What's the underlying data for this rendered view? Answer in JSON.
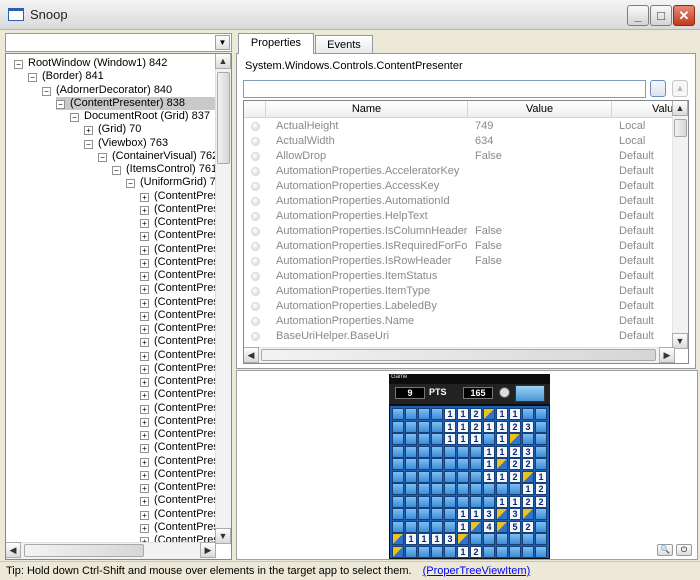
{
  "window": {
    "title": "Snoop",
    "min_symbol": "_",
    "max_symbol": "□",
    "close_symbol": "✕",
    "icon": "window-icon"
  },
  "tree": {
    "items": [
      {
        "label": "RootWindow (Window1) 842",
        "level": 0,
        "expander": "⊟"
      },
      {
        "label": "(Border) 841",
        "level": 1,
        "expander": "⊟"
      },
      {
        "label": "(AdornerDecorator) 840",
        "level": 2,
        "expander": "⊟"
      },
      {
        "label": "(ContentPresenter) 838",
        "level": 3,
        "expander": "⊟",
        "selected": true
      },
      {
        "label": "DocumentRoot (Grid) 837",
        "level": 4,
        "expander": "⊟"
      },
      {
        "label": "(Grid) 70",
        "level": 5,
        "expander": "⊞"
      },
      {
        "label": "(Viewbox) 763",
        "level": 5,
        "expander": "⊟"
      },
      {
        "label": "(ContainerVisual) 762",
        "level": 6,
        "expander": "⊟"
      },
      {
        "label": "(ItemsControl) 761",
        "level": 7,
        "expander": "⊟"
      },
      {
        "label": "(UniformGrid) 760",
        "level": 8,
        "expander": "⊟"
      },
      {
        "label": "(ContentPresen",
        "level": 9,
        "expander": "⊞"
      },
      {
        "label": "(ContentPresen",
        "level": 9,
        "expander": "⊞"
      },
      {
        "label": "(ContentPresen",
        "level": 9,
        "expander": "⊞"
      },
      {
        "label": "(ContentPresen",
        "level": 9,
        "expander": "⊞"
      },
      {
        "label": "(ContentPresen",
        "level": 9,
        "expander": "⊞"
      },
      {
        "label": "(ContentPresen",
        "level": 9,
        "expander": "⊞"
      },
      {
        "label": "(ContentPresen",
        "level": 9,
        "expander": "⊞"
      },
      {
        "label": "(ContentPresen",
        "level": 9,
        "expander": "⊞"
      },
      {
        "label": "(ContentPresen",
        "level": 9,
        "expander": "⊞"
      },
      {
        "label": "(ContentPresen",
        "level": 9,
        "expander": "⊞"
      },
      {
        "label": "(ContentPresen",
        "level": 9,
        "expander": "⊞"
      },
      {
        "label": "(ContentPresen",
        "level": 9,
        "expander": "⊞"
      },
      {
        "label": "(ContentPresen",
        "level": 9,
        "expander": "⊞"
      },
      {
        "label": "(ContentPresen",
        "level": 9,
        "expander": "⊞"
      },
      {
        "label": "(ContentPresen",
        "level": 9,
        "expander": "⊞"
      },
      {
        "label": "(ContentPresen",
        "level": 9,
        "expander": "⊞"
      },
      {
        "label": "(ContentPresen",
        "level": 9,
        "expander": "⊞"
      },
      {
        "label": "(ContentPresen",
        "level": 9,
        "expander": "⊞"
      },
      {
        "label": "(ContentPresen",
        "level": 9,
        "expander": "⊞"
      },
      {
        "label": "(ContentPresen",
        "level": 9,
        "expander": "⊞"
      },
      {
        "label": "(ContentPresen",
        "level": 9,
        "expander": "⊞"
      },
      {
        "label": "(ContentPresen",
        "level": 9,
        "expander": "⊞"
      },
      {
        "label": "(ContentPresen",
        "level": 9,
        "expander": "⊞"
      },
      {
        "label": "(ContentPresen",
        "level": 9,
        "expander": "⊞"
      },
      {
        "label": "(ContentPresen",
        "level": 9,
        "expander": "⊞"
      },
      {
        "label": "(ContentPresen",
        "level": 9,
        "expander": "⊞"
      },
      {
        "label": "(ContentPresen",
        "level": 9,
        "expander": "⊞"
      }
    ]
  },
  "tabs": [
    {
      "label": "Properties",
      "active": true
    },
    {
      "label": "Events",
      "active": false
    }
  ],
  "properties": {
    "type_name": "System.Windows.Controls.ContentPresenter",
    "filter_value": "",
    "columns": [
      "Name",
      "Value",
      "Valu"
    ],
    "rows": [
      {
        "name": "ActualHeight",
        "value": "749",
        "source": "Local"
      },
      {
        "name": "ActualWidth",
        "value": "634",
        "source": "Local"
      },
      {
        "name": "AllowDrop",
        "value": "False",
        "source": "Default"
      },
      {
        "name": "AutomationProperties.AcceleratorKey",
        "value": "",
        "source": "Default"
      },
      {
        "name": "AutomationProperties.AccessKey",
        "value": "",
        "source": "Default"
      },
      {
        "name": "AutomationProperties.AutomationId",
        "value": "",
        "source": "Default"
      },
      {
        "name": "AutomationProperties.HelpText",
        "value": "",
        "source": "Default"
      },
      {
        "name": "AutomationProperties.IsColumnHeader",
        "value": "False",
        "source": "Default"
      },
      {
        "name": "AutomationProperties.IsRequiredForFo",
        "value": "False",
        "source": "Default"
      },
      {
        "name": "AutomationProperties.IsRowHeader",
        "value": "False",
        "source": "Default"
      },
      {
        "name": "AutomationProperties.ItemStatus",
        "value": "",
        "source": "Default"
      },
      {
        "name": "AutomationProperties.ItemType",
        "value": "",
        "source": "Default"
      },
      {
        "name": "AutomationProperties.LabeledBy",
        "value": "",
        "source": "Default"
      },
      {
        "name": "AutomationProperties.Name",
        "value": "",
        "source": "Default"
      },
      {
        "name": "BaseUriHelper.BaseUri",
        "value": "",
        "source": "Default"
      }
    ]
  },
  "preview": {
    "game": {
      "title": "Game",
      "score_left": "9",
      "score_label": "PTS",
      "score_right": "165",
      "board": [
        "    112F11      ",
        "    1121123     ",
        "    111 1F      ",
        "       1123     ",
        "       1F22     ",
        "       112F1    ",
        "          12    ",
        "        1122    ",
        "     113F3F     ",
        "     1F4F52     ",
        "F1113F          ",
        "F    12         "
      ]
    }
  },
  "status": {
    "tip": "Tip: Hold down Ctrl-Shift and mouse over elements in the target app to select them.",
    "link": "(ProperTreeViewItem)"
  }
}
